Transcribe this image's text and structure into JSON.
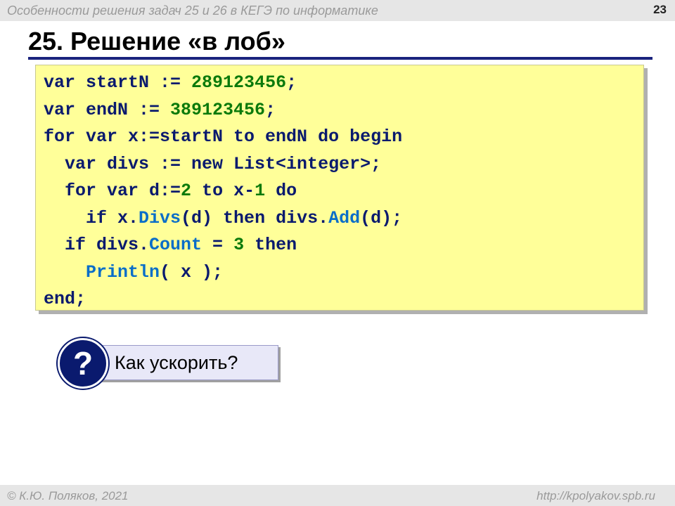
{
  "header": {
    "title": "Особенности решения задач 25 и 26 в КЕГЭ по информатике",
    "page_number": "23"
  },
  "slide": {
    "title": "25. Решение «в лоб»"
  },
  "code": {
    "lines": [
      [
        {
          "t": "var startN := ",
          "c": "kw"
        },
        {
          "t": "289123456",
          "c": "num"
        },
        {
          "t": ";",
          "c": "kw"
        }
      ],
      [
        {
          "t": "var endN := ",
          "c": "kw"
        },
        {
          "t": "389123456",
          "c": "num"
        },
        {
          "t": ";",
          "c": "kw"
        }
      ],
      [
        {
          "t": "for var x:=startN to endN do begin",
          "c": "kw"
        }
      ],
      [
        {
          "t": "  var divs := new List<integer>;",
          "c": "kw"
        }
      ],
      [
        {
          "t": "  for var d:=",
          "c": "kw"
        },
        {
          "t": "2",
          "c": "num"
        },
        {
          "t": " to x-",
          "c": "kw"
        },
        {
          "t": "1",
          "c": "num"
        },
        {
          "t": " do",
          "c": "kw"
        }
      ],
      [
        {
          "t": "    if x.",
          "c": "kw"
        },
        {
          "t": "Divs",
          "c": "meth"
        },
        {
          "t": "(d) then divs.",
          "c": "kw"
        },
        {
          "t": "Add",
          "c": "meth"
        },
        {
          "t": "(d);",
          "c": "kw"
        }
      ],
      [
        {
          "t": "  if divs.",
          "c": "kw"
        },
        {
          "t": "Count",
          "c": "meth"
        },
        {
          "t": " = ",
          "c": "kw"
        },
        {
          "t": "3",
          "c": "num"
        },
        {
          "t": " then",
          "c": "kw"
        }
      ],
      [
        {
          "t": "    ",
          "c": "kw"
        },
        {
          "t": "Println",
          "c": "meth"
        },
        {
          "t": "( x );",
          "c": "kw"
        }
      ],
      [
        {
          "t": "end;",
          "c": "kw"
        }
      ]
    ]
  },
  "question": {
    "symbol": "?",
    "text": "Как ускорить?"
  },
  "footer": {
    "author": "© К.Ю. Поляков, 2021",
    "url": "http://kpolyakov.spb.ru"
  },
  "colors": {
    "code_background": "#ffff99",
    "keyword": "#0a1a6e",
    "number": "#0b7a0b",
    "method": "#0a6ec8",
    "title_rule": "#1a237e"
  }
}
